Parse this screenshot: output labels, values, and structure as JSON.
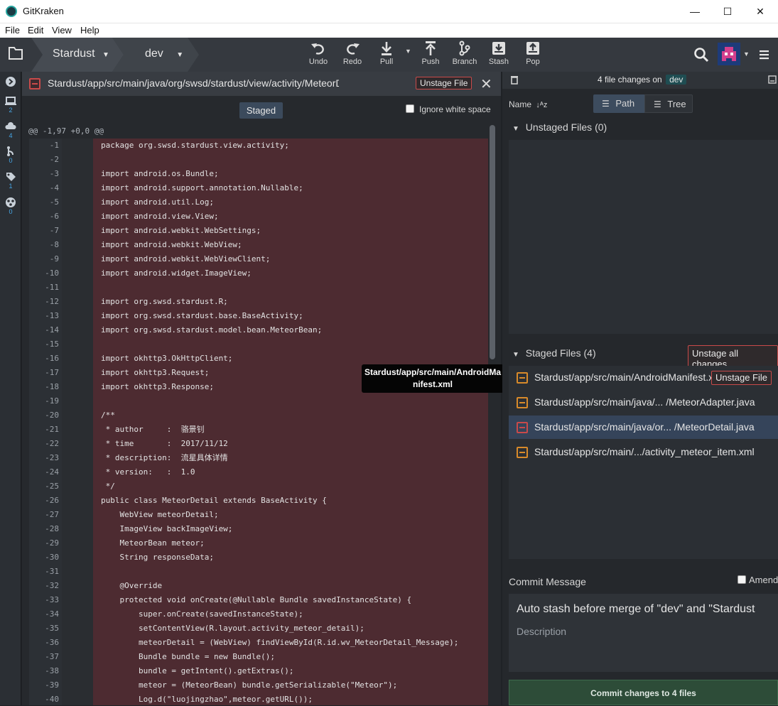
{
  "window": {
    "title": "GitKraken",
    "minimize_glyph": "—",
    "maximize_glyph": "☐",
    "close_glyph": "✕"
  },
  "menu": {
    "file": "File",
    "edit": "Edit",
    "view": "View",
    "help": "Help"
  },
  "toolbar": {
    "repo": "Stardust",
    "branch": "dev",
    "undo": "Undo",
    "redo": "Redo",
    "pull": "Pull",
    "push": "Push",
    "branch_btn": "Branch",
    "stash": "Stash",
    "pop": "Pop"
  },
  "leftnav": {
    "local_count": "2",
    "remote_count": "4",
    "pr_count": "0",
    "tags_count": "1",
    "submodules_count": "0"
  },
  "diff": {
    "path": "Stardust/app/src/main/java/org/swsd/stardust/view/activity/MeteorDetail.java",
    "unstage_label": "Unstage File",
    "close_glyph": "✕",
    "staged_tag": "Staged",
    "ignore_ws_label": "Ignore white space",
    "hunk_header": "@@ -1,97 +0,0 @@",
    "lines": [
      {
        "n": "-1",
        "t": "package org.swsd.stardust.view.activity;"
      },
      {
        "n": "-2",
        "t": ""
      },
      {
        "n": "-3",
        "t": "import android.os.Bundle;"
      },
      {
        "n": "-4",
        "t": "import android.support.annotation.Nullable;"
      },
      {
        "n": "-5",
        "t": "import android.util.Log;"
      },
      {
        "n": "-6",
        "t": "import android.view.View;"
      },
      {
        "n": "-7",
        "t": "import android.webkit.WebSettings;"
      },
      {
        "n": "-8",
        "t": "import android.webkit.WebView;"
      },
      {
        "n": "-9",
        "t": "import android.webkit.WebViewClient;"
      },
      {
        "n": "-10",
        "t": "import android.widget.ImageView;"
      },
      {
        "n": "-11",
        "t": ""
      },
      {
        "n": "-12",
        "t": "import org.swsd.stardust.R;"
      },
      {
        "n": "-13",
        "t": "import org.swsd.stardust.base.BaseActivity;"
      },
      {
        "n": "-14",
        "t": "import org.swsd.stardust.model.bean.MeteorBean;"
      },
      {
        "n": "-15",
        "t": ""
      },
      {
        "n": "-16",
        "t": "import okhttp3.OkHttpClient;"
      },
      {
        "n": "-17",
        "t": "import okhttp3.Request;"
      },
      {
        "n": "-18",
        "t": "import okhttp3.Response;"
      },
      {
        "n": "-19",
        "t": ""
      },
      {
        "n": "-20",
        "t": "/**"
      },
      {
        "n": "-21",
        "t": " * author     :  骆景钊"
      },
      {
        "n": "-22",
        "t": " * time       :  2017/11/12"
      },
      {
        "n": "-23",
        "t": " * description:  流星具体详情"
      },
      {
        "n": "-24",
        "t": " * version:   :  1.0"
      },
      {
        "n": "-25",
        "t": " */"
      },
      {
        "n": "-26",
        "t": "public class MeteorDetail extends BaseActivity {"
      },
      {
        "n": "-27",
        "t": "    WebView meteorDetail;"
      },
      {
        "n": "-28",
        "t": "    ImageView backImageView;"
      },
      {
        "n": "-29",
        "t": "    MeteorBean meteor;"
      },
      {
        "n": "-30",
        "t": "    String responseData;"
      },
      {
        "n": "-31",
        "t": ""
      },
      {
        "n": "-32",
        "t": "    @Override"
      },
      {
        "n": "-33",
        "t": "    protected void onCreate(@Nullable Bundle savedInstanceState) {"
      },
      {
        "n": "-34",
        "t": "        super.onCreate(savedInstanceState);"
      },
      {
        "n": "-35",
        "t": "        setContentView(R.layout.activity_meteor_detail);"
      },
      {
        "n": "-36",
        "t": "        meteorDetail = (WebView) findViewById(R.id.wv_MeteorDetail_Message);"
      },
      {
        "n": "-37",
        "t": "        Bundle bundle = new Bundle();"
      },
      {
        "n": "-38",
        "t": "        bundle = getIntent().getExtras();"
      },
      {
        "n": "-39",
        "t": "        meteor = (MeteorBean) bundle.getSerializable(\"Meteor\");"
      },
      {
        "n": "-40",
        "t": "        Log.d(\"luojingzhao\",meteor.getURL());"
      }
    ]
  },
  "tooltip": {
    "line1": "Stardust/app/src/main/AndroidMa",
    "line2": "nifest.xml"
  },
  "right": {
    "changes_text": "4 file changes on",
    "branch": "dev",
    "name_label": "Name",
    "path_tab": "Path",
    "tree_tab": "Tree",
    "unstaged_title": "Unstaged Files (0)",
    "staged_title": "Staged Files (4)",
    "unstage_all": "Unstage all changes",
    "unstage_file": "Unstage File",
    "staged_files": [
      {
        "name": "Stardust/app/src/main/AndroidManifest.xml"
      },
      {
        "name": "Stardust/app/src/main/java/... /MeteorAdapter.java"
      },
      {
        "name": "Stardust/app/src/main/java/or... /MeteorDetail.java"
      },
      {
        "name": "Stardust/app/src/main/.../activity_meteor_item.xml"
      }
    ],
    "commit_message_label": "Commit Message",
    "amend_label": "Amend",
    "summary": "Auto stash before merge of \"dev\" and \"Stardust",
    "description_placeholder": "Description",
    "commit_btn": "Commit changes to 4 files"
  },
  "colors": {
    "removed_line_bg": "#4d2b31",
    "accent_red": "#c94a4a",
    "modified_orange": "#d88a2a",
    "commit_green": "#2d4c38"
  }
}
